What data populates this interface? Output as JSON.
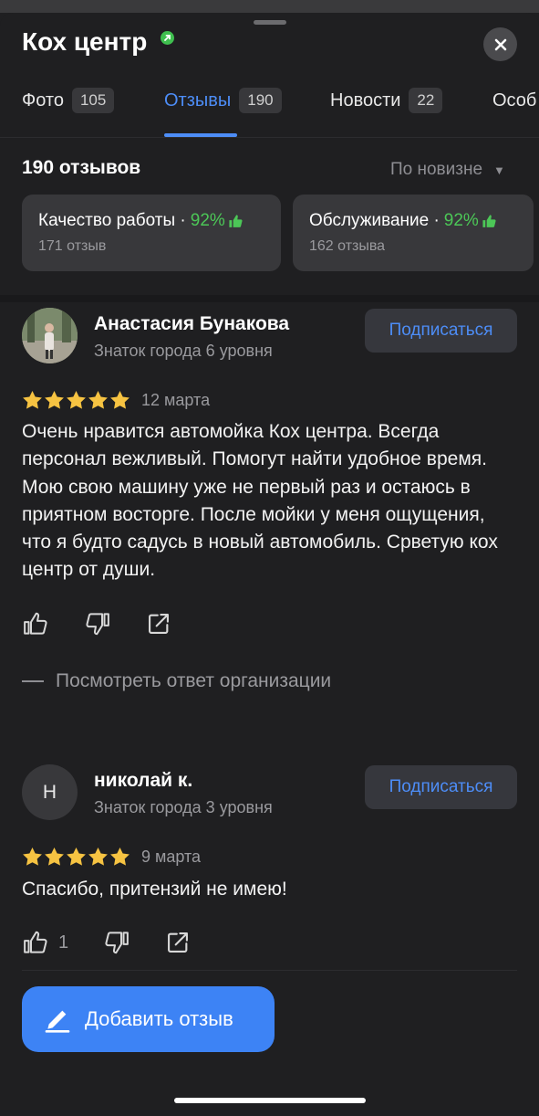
{
  "header": {
    "title": "Кох центр",
    "close_icon": "close-icon",
    "verified_icon": "verified-badge-icon"
  },
  "tabs": [
    {
      "label": "Фото",
      "count": "105",
      "active": false
    },
    {
      "label": "Отзывы",
      "count": "190",
      "active": true
    },
    {
      "label": "Новости",
      "count": "22",
      "active": false
    },
    {
      "label": "Особ",
      "count": "",
      "active": false
    }
  ],
  "summary": {
    "total": "190 отзывов",
    "sort_label": "По новизне"
  },
  "aspects": [
    {
      "title": "Качество работы ·",
      "percent": "92%",
      "count": "171 отзыв"
    },
    {
      "title": "Обслуживание ·",
      "percent": "92%",
      "count": "162 отзыва"
    }
  ],
  "reviews": [
    {
      "author": "Анастасия Бунакова",
      "level": "Знаток города 6 уровня",
      "subscribe_label": "Подписаться",
      "rating": 5,
      "date": "12 марта",
      "text": "Очень нравится автомойка Кох центра. Всегда персонал вежливый. Помогут найти удобное время. Мою свою машину уже не первый раз и остаюсь в приятном восторге. После мойки у меня ощущения, что я будто садусь в новый автомобиль. Срветую кох центр от души.",
      "likes": "",
      "org_answer_label": "Посмотреть ответ организации"
    },
    {
      "author": "николай к.",
      "avatar_letter": "Н",
      "level": "Знаток города 3 уровня",
      "subscribe_label": "Подписаться",
      "rating": 5,
      "date": "9 марта",
      "text": "Спасибо, притензий не имею!",
      "likes": "1"
    }
  ],
  "footer": {
    "add_review_label": "Добавить отзыв"
  },
  "colors": {
    "background": "#1f1f21",
    "accent": "#4d8df7",
    "button_primary": "#3d83f5",
    "positive": "#4cc757",
    "star": "#f6c342"
  }
}
